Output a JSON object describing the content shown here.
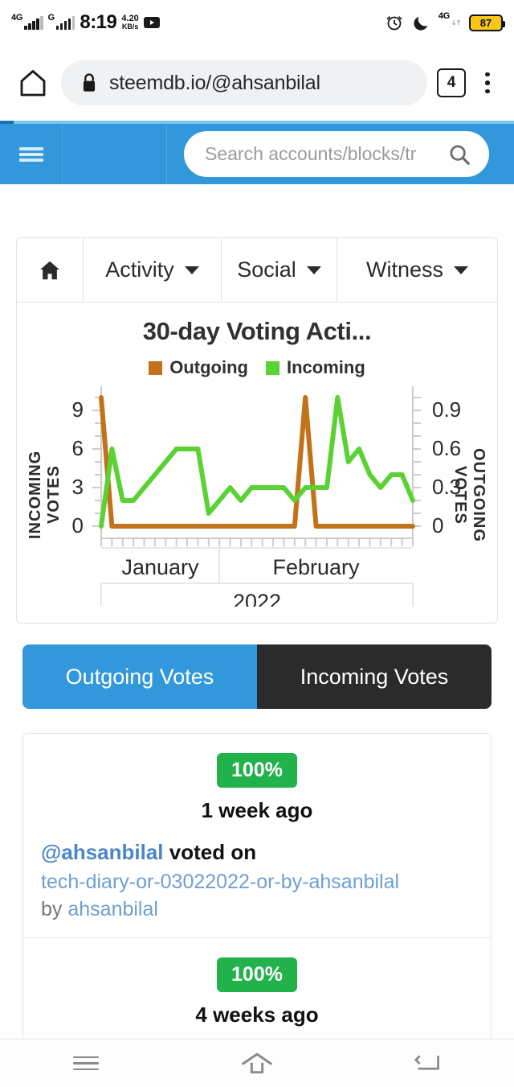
{
  "status_bar": {
    "network_primary": "4G",
    "network_secondary": "G",
    "time": "8:19",
    "netspeed_value": "4.20",
    "netspeed_unit": "KB/s",
    "media_icon": "youtube-icon",
    "alarm_icon": "alarm-clock-icon",
    "dnd_icon": "crescent-moon-icon",
    "sim_network": "4G",
    "battery_percent": "87"
  },
  "browser": {
    "home_icon": "home-icon",
    "lock_icon": "padlock-icon",
    "url": "steemdb.io/@ahsanbilal",
    "tab_count": "4",
    "menu_icon": "kebab-menu-icon"
  },
  "site_nav": {
    "menu_icon": "hamburger-icon",
    "search_placeholder": "Search accounts/blocks/tr",
    "search_value": "",
    "search_icon": "magnifier-icon",
    "background": "#3398db"
  },
  "tabs": [
    {
      "label": "",
      "icon": "home-icon",
      "has_caret": false,
      "name": "tab-home"
    },
    {
      "label": "Activity",
      "icon": "",
      "has_caret": true,
      "name": "tab-activity"
    },
    {
      "label": "Social",
      "icon": "",
      "has_caret": true,
      "name": "tab-social"
    },
    {
      "label": "Witness",
      "icon": "",
      "has_caret": true,
      "name": "tab-witness"
    }
  ],
  "chart_data": {
    "type": "line",
    "title": "30-day Voting Acti...",
    "xlabel": "2022",
    "ylabel": "INCOMING VOTES",
    "ylabel_right": "OUTGOING VOTES",
    "grid": false,
    "legend_position": "top",
    "legend": [
      {
        "name": "Outgoing",
        "color": "#c3711a"
      },
      {
        "name": "Incoming",
        "color": "#5ad234"
      }
    ],
    "x_tick_labels": [
      "January",
      "February"
    ],
    "x_axis_group_label": "2022",
    "left_axis": {
      "label": "INCOMING VOTES",
      "ticks": [
        "0",
        "3",
        "6",
        "9"
      ],
      "ylim": [
        0,
        10.5
      ]
    },
    "right_axis": {
      "label": "OUTGOING VOTES",
      "ticks": [
        "0",
        "0.3",
        "0.6",
        "0.9"
      ],
      "ylim": [
        0,
        1.05
      ]
    },
    "x": [
      1,
      2,
      3,
      4,
      5,
      6,
      7,
      8,
      9,
      10,
      11,
      12,
      13,
      14,
      15,
      16,
      17,
      18,
      19,
      20,
      21,
      22,
      23,
      24,
      25,
      26,
      27,
      28,
      29,
      30
    ],
    "series": [
      {
        "name": "Outgoing",
        "color": "#c3711a",
        "axis": "right",
        "values": [
          1,
          0,
          0,
          0,
          0,
          0,
          0,
          0,
          0,
          0,
          0,
          0,
          0,
          0,
          0,
          0,
          0,
          0,
          0,
          1,
          0,
          0,
          0,
          0,
          0,
          0,
          0,
          0,
          0,
          0
        ]
      },
      {
        "name": "Incoming",
        "color": "#5ad234",
        "axis": "left",
        "values": [
          0,
          6,
          2,
          2,
          3,
          4,
          5,
          6,
          6,
          6,
          1,
          2,
          3,
          2,
          3,
          3,
          3,
          3,
          2,
          3,
          3,
          3,
          10,
          5,
          6,
          4,
          3,
          4,
          4,
          2
        ]
      }
    ]
  },
  "vote_toggle": {
    "outgoing_label": "Outgoing Votes",
    "incoming_label": "Incoming Votes",
    "active": "Outgoing Votes",
    "active_color": "#3398db",
    "inactive_color": "#2b2b2b"
  },
  "votes": [
    {
      "percent": "100%",
      "percent_color": "#22b24c",
      "time_ago": "1 week ago",
      "voter": "@ahsanbilal",
      "action": "voted on",
      "permlink": "tech-diary-or-03022022-or-by-ahsanbilal",
      "by_label": "by",
      "author": "ahsanbilal"
    },
    {
      "percent": "100%",
      "percent_color": "#22b24c",
      "time_ago": "4 weeks ago",
      "voter": "",
      "action": "",
      "permlink": "",
      "by_label": "",
      "author": ""
    }
  ],
  "bottom_nav": [
    {
      "name": "recent-apps-button",
      "icon": "hamburger-icon"
    },
    {
      "name": "home-button",
      "icon": "home-outline-icon"
    },
    {
      "name": "back-button",
      "icon": "back-arrow-icon"
    }
  ]
}
